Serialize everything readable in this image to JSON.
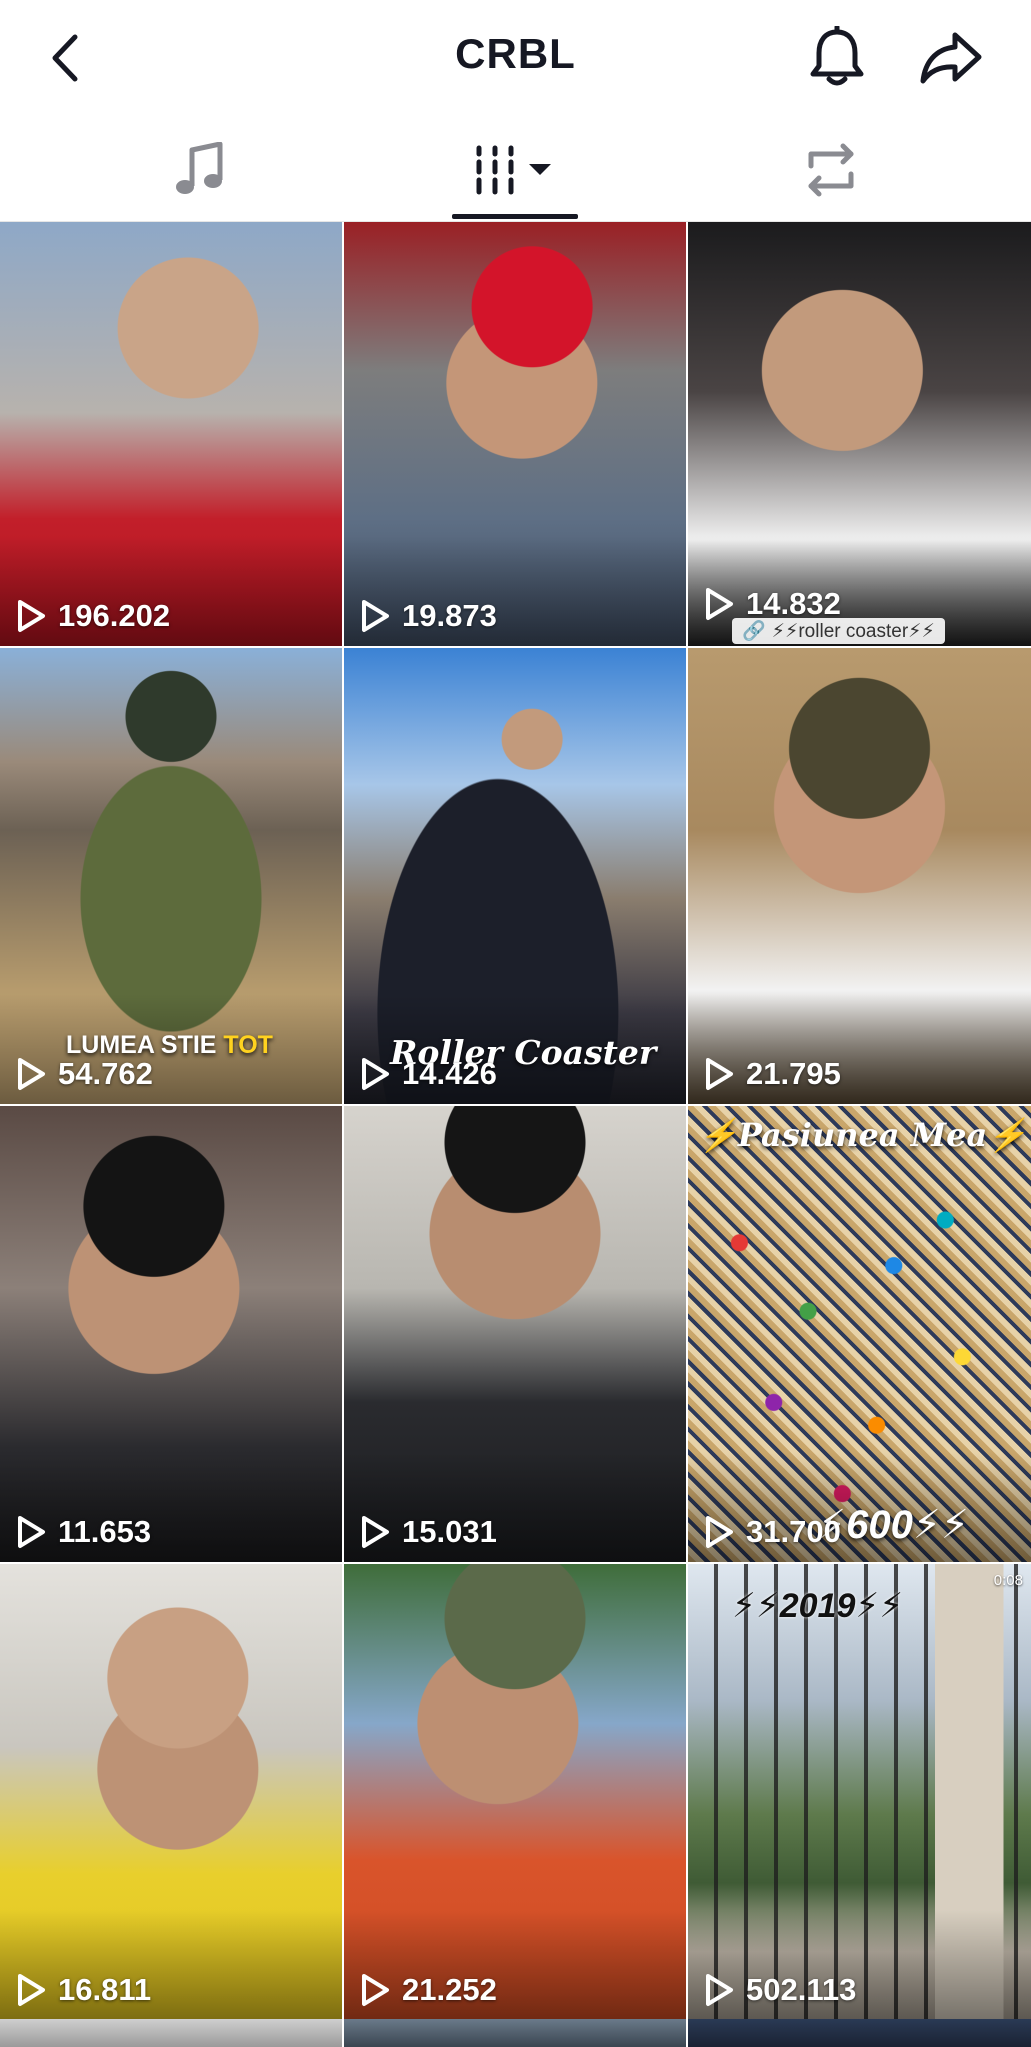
{
  "header": {
    "title": "CRBL",
    "icons": {
      "back": "back-arrow-icon",
      "bell": "bell-icon",
      "share": "share-arrow-icon"
    }
  },
  "tabs": [
    {
      "name": "music",
      "icon": "music-note-icon"
    },
    {
      "name": "videos",
      "icon": "grid-columns-icon",
      "selected": true
    },
    {
      "name": "reposts",
      "icon": "repost-icon"
    }
  ],
  "videos": [
    {
      "views": "196.202",
      "caption": ""
    },
    {
      "views": "19.873",
      "caption": ""
    },
    {
      "views": "14.832",
      "caption": "",
      "link_text": "⚡⚡roller coaster⚡⚡"
    },
    {
      "views": "54.762",
      "caption": "LUMEA STIE",
      "caption_highlight": "TOT"
    },
    {
      "views": "14.426",
      "caption": "Roller Coaster"
    },
    {
      "views": "21.795",
      "caption": ""
    },
    {
      "views": "11.653",
      "caption": ""
    },
    {
      "views": "15.031",
      "caption": ""
    },
    {
      "views": "31.700",
      "caption_top": "⚡Pasiunea Mea⚡",
      "caption_bottom": "⚡600⚡⚡"
    },
    {
      "views": "16.811",
      "caption": ""
    },
    {
      "views": "21.252",
      "caption": ""
    },
    {
      "views": "502.113",
      "caption_top": "⚡⚡2019⚡⚡",
      "duration": "0:08"
    }
  ],
  "colors": {
    "text": "#161823",
    "accent_yellow": "#ffd21f",
    "overlay_text": "#ffffff"
  }
}
